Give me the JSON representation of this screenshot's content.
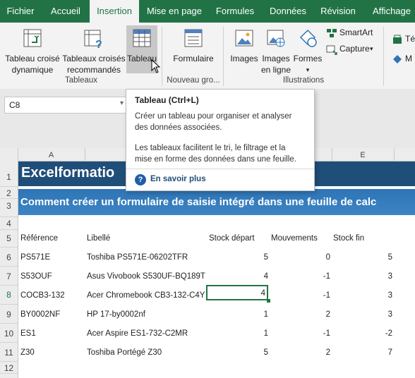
{
  "tabs": [
    "Fichier",
    "Accueil",
    "Insertion",
    "Mise en page",
    "Formules",
    "Données",
    "Révision",
    "Affichage"
  ],
  "ribbon": {
    "pivot_label": "Tableau croisé dynamique",
    "pivot_line1": "Tableau croisé",
    "pivot_line2": "dynamique",
    "recommended_line1": "Tableaux croisés",
    "recommended_line2": "recommandés",
    "table_label": "Tableau",
    "group_tables": "Tableaux",
    "form_label": "Formulaire",
    "group_new": "Nouveau gro...",
    "images_label": "Images",
    "online_line1": "Images",
    "online_line2": "en ligne",
    "shapes_label": "Formes",
    "smartart_label": "SmartArt",
    "capture_label": "Capture",
    "group_illustrations": "Illustrations",
    "cut_label_1": "Té",
    "cut_label_2": "M"
  },
  "namebox": {
    "value": "C8"
  },
  "columns": [
    "A",
    "E"
  ],
  "rows": [
    "1",
    "2",
    "3",
    "4",
    "5",
    "6",
    "7",
    "8",
    "9",
    "10",
    "11",
    "12"
  ],
  "sheet": {
    "title": "Excelformatio",
    "subtitle": "Comment créer un formulaire de saisie intégré dans une feuille de calc",
    "headers": [
      "Référence",
      "Libellé",
      "Stock départ",
      "Mouvements",
      "Stock fin"
    ],
    "data": [
      [
        "PS571E",
        "Toshiba PS571E-06202TFR",
        "5",
        "0",
        "5"
      ],
      [
        "S53OUF",
        "Asus Vivobook S530UF-BQ189T",
        "4",
        "-1",
        "3"
      ],
      [
        "COCB3-132",
        "Acer Chromebook CB3-132-C4Y",
        "4",
        "-1",
        "3"
      ],
      [
        "BY0002NF",
        "HP 17-by0002nf",
        "1",
        "2",
        "3"
      ],
      [
        "ES1",
        "Acer Aspire ES1-732-C2MR",
        "1",
        "-1",
        "-2"
      ],
      [
        "Z30",
        "Toshiba Portégé Z30",
        "5",
        "2",
        "7"
      ]
    ]
  },
  "tooltip": {
    "title": "Tableau (Ctrl+L)",
    "para1_line1": "Créer un tableau pour organiser et analyser",
    "para1_line2": "des données associées.",
    "para2_line1": "Les tableaux facilitent le tri, le filtrage et la",
    "para2_line2": "mise en forme des données dans une feuille.",
    "link": "En savoir plus"
  },
  "colors": {
    "excel_green": "#217346",
    "title_bar": "#1f4e79",
    "subtitle_bar": "#2e75b6",
    "link_blue": "#1f4e79"
  }
}
